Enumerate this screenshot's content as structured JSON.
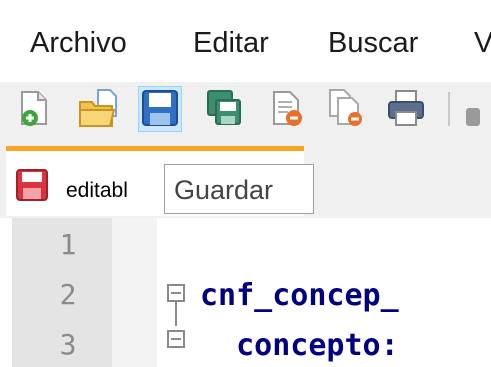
{
  "menu": {
    "items": [
      {
        "label": "Archivo"
      },
      {
        "label": "Editar"
      },
      {
        "label": "Buscar"
      },
      {
        "label": "V"
      }
    ]
  },
  "toolbar": {
    "buttons": [
      {
        "icon": "new-file-icon"
      },
      {
        "icon": "open-folder-icon"
      },
      {
        "icon": "save-icon",
        "selected": true
      },
      {
        "icon": "save-all-icon"
      },
      {
        "icon": "close-file-icon"
      },
      {
        "icon": "close-all-icon"
      },
      {
        "icon": "print-icon"
      }
    ]
  },
  "tab": {
    "label": "editabl",
    "icon": "unsaved-file-icon"
  },
  "tooltip": {
    "text": "Guardar"
  },
  "editor": {
    "lines": [
      {
        "number": "1",
        "code": ""
      },
      {
        "number": "2",
        "code": "cnf_concep_"
      },
      {
        "number": "3",
        "code": "  concepto:"
      }
    ]
  },
  "colors": {
    "tab_accent": "#f5a623",
    "keyword": "#000080",
    "selection": "#cce8ff"
  }
}
